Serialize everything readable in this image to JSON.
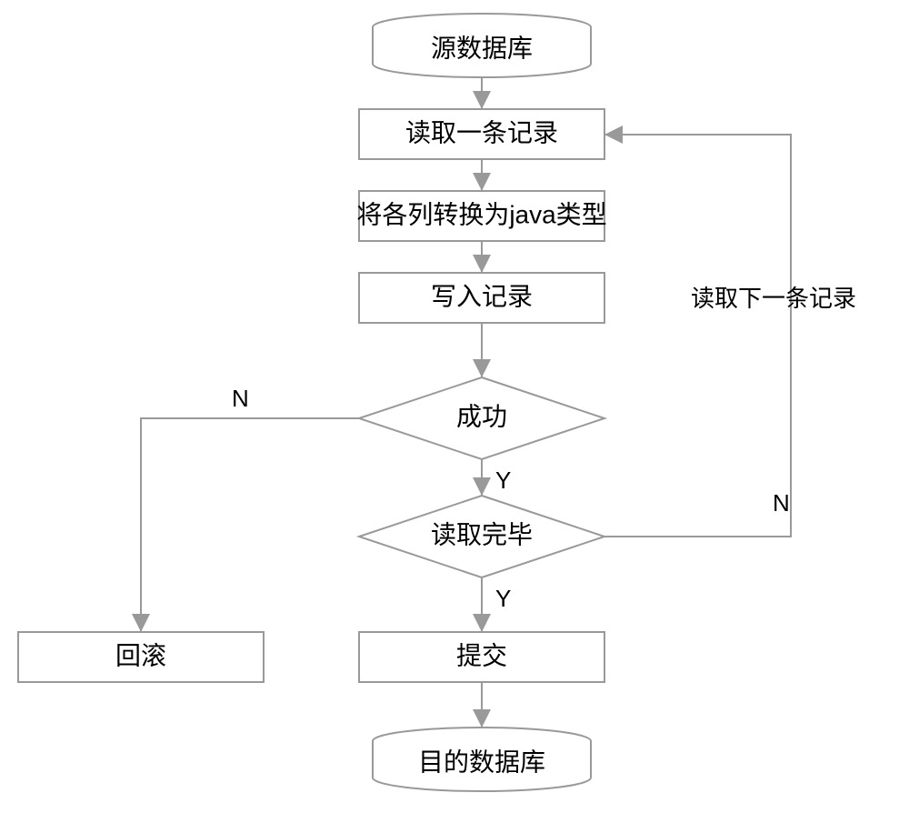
{
  "nodes": {
    "source_db": "源数据库",
    "read_record": "读取一条记录",
    "convert_java": "将各列转换为java类型",
    "write_record": "写入记录",
    "success": "成功",
    "read_done": "读取完毕",
    "commit": "提交",
    "rollback": "回滚",
    "target_db": "目的数据库"
  },
  "labels": {
    "yes": "Y",
    "no": "N",
    "read_next": "读取下一条记录"
  }
}
